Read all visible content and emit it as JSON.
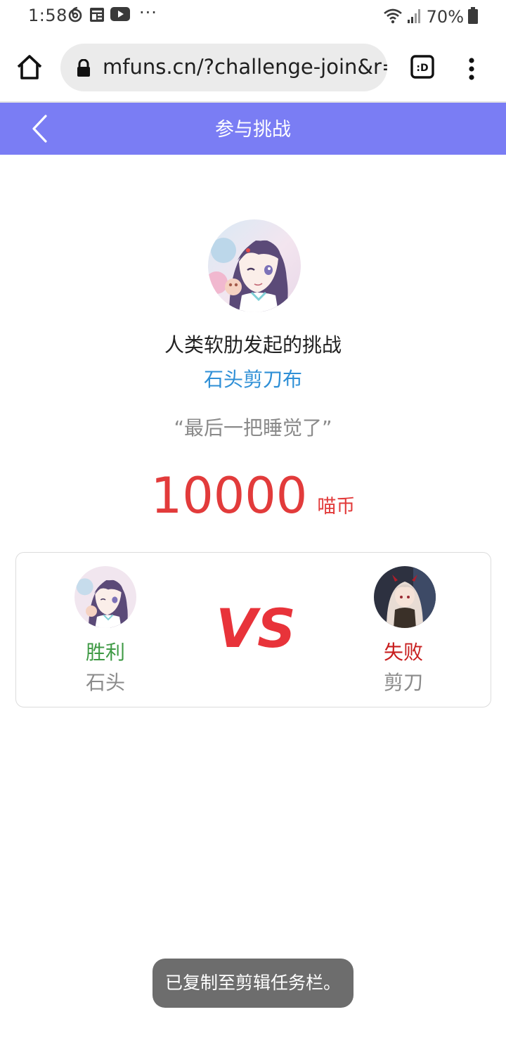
{
  "status_bar": {
    "time": "1:58",
    "overflow": "···",
    "battery": "70%",
    "icons": [
      "netease-music-icon",
      "news-icon",
      "youtube-icon",
      "wifi-icon",
      "signal-icon",
      "battery-icon"
    ]
  },
  "browser": {
    "url": "mfuns.cn/?challenge-join&r=",
    "tabs_label": ":D"
  },
  "header": {
    "title": "参与挑战",
    "color": "#7a7df4"
  },
  "challenge": {
    "challenger_text": "人类软肋发起的挑战",
    "game_name": "石头剪刀布",
    "quote": "“最后一把睡觉了”",
    "amount": "10000",
    "currency": "喵币"
  },
  "result": {
    "vs": "VS",
    "player1": {
      "result": "胜利",
      "move": "石头"
    },
    "player2": {
      "result": "失败",
      "move": "剪刀"
    }
  },
  "toast": {
    "message": "已复制至剪辑任务栏。"
  },
  "colors": {
    "accent": "#7a7df4",
    "link_blue": "#2e8fd6",
    "stake_red": "#e23b3b",
    "win_green": "#3f9a45",
    "lose_red": "#c81e1e"
  }
}
